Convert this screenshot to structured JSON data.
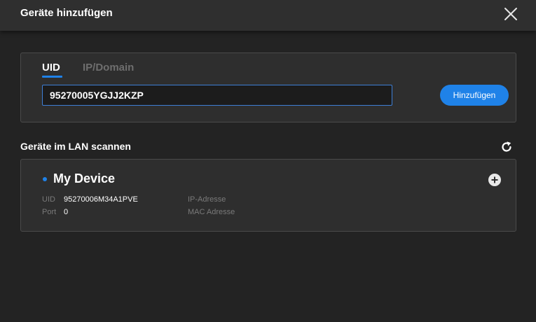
{
  "dialog": {
    "title": "Geräte hinzufügen"
  },
  "tabs": [
    {
      "label": "UID",
      "active": true
    },
    {
      "label": "IP/Domain",
      "active": false
    }
  ],
  "uid_input": {
    "value": "95270005YGJJ2KZP"
  },
  "add_button": {
    "label": "Hinzufügen"
  },
  "lan_scan": {
    "title": "Geräte im LAN scannen"
  },
  "device": {
    "name": "My Device",
    "uid_label": "UID",
    "uid_value": "95270006M34A1PVE",
    "port_label": "Port",
    "port_value": "0",
    "ip_label": "IP-Adresse",
    "mac_label": "MAC Adresse"
  },
  "colors": {
    "accent": "#1f82e8",
    "background": "#232323",
    "panel": "#2e2e2e",
    "titlebar": "#2f2f2f"
  },
  "icons": {
    "close": "close-icon",
    "refresh": "refresh-icon",
    "add_device": "plus-circle-icon"
  }
}
